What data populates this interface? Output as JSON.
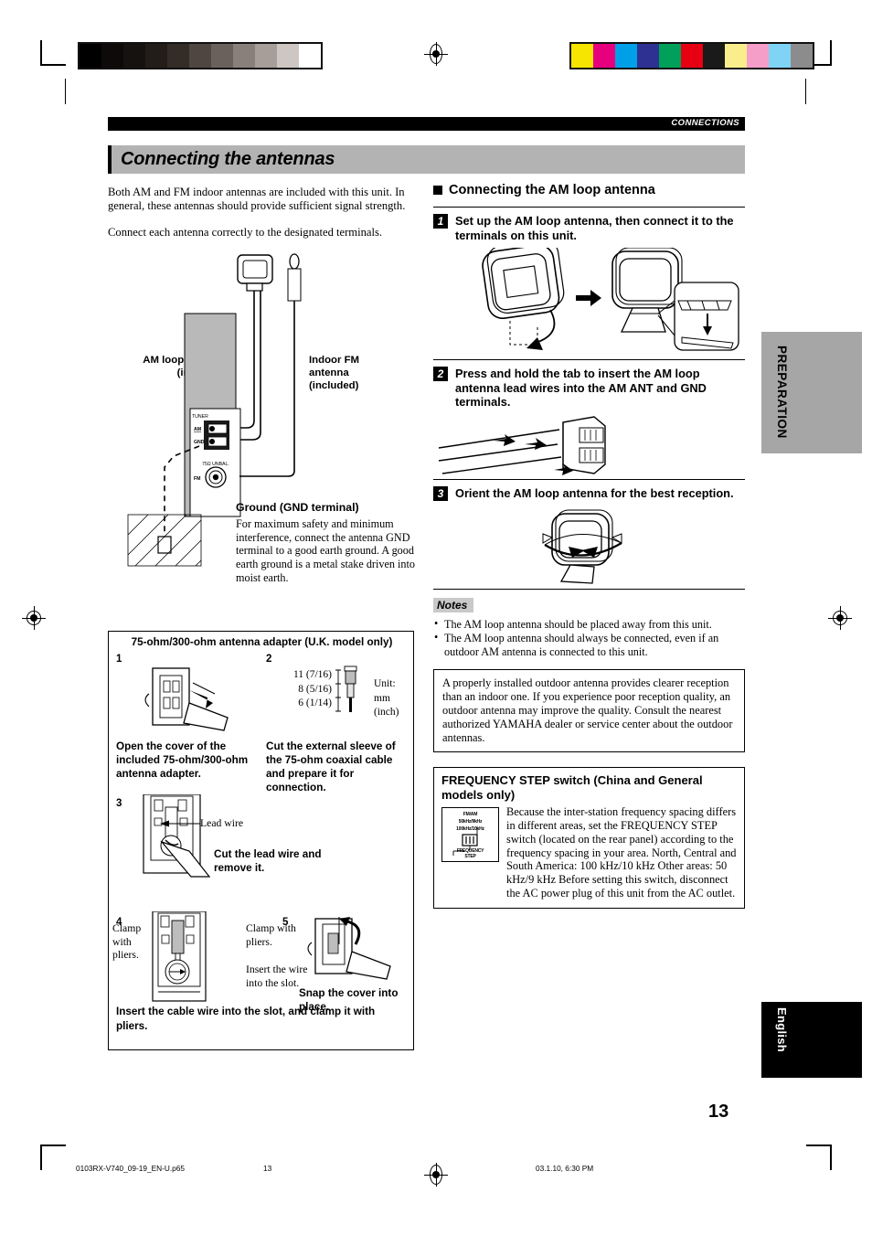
{
  "header": {
    "running_head": "CONNECTIONS"
  },
  "title": "Connecting the antennas",
  "intro": {
    "p1": "Both AM and FM indoor antennas are included with this unit. In general, these antennas should provide sufficient signal strength.",
    "p2": "Connect each antenna correctly to the designated terminals."
  },
  "diagram": {
    "am_label": "AM loop antenna",
    "am_label2": "(included)",
    "fm_label": "Indoor FM",
    "fm_label2": "antenna",
    "fm_label3": "(included)",
    "panel_tuner": "TUNER",
    "panel_am": "AM",
    "panel_gnd": "GND",
    "panel_unbal": "75Ω UNBAL.",
    "panel_fm": "FM",
    "gnd_heading": "Ground (GND terminal)",
    "gnd_text": "For maximum safety and minimum interference, connect the antenna GND terminal to a good earth ground. A good earth ground is a metal stake driven into moist earth."
  },
  "adapter": {
    "caption": "75-ohm/300-ohm antenna adapter (U.K. model only)",
    "steps": [
      {
        "num": "1",
        "text": "Open the cover of the included 75-ohm/300-ohm antenna adapter."
      },
      {
        "num": "2",
        "text": "Cut the external sleeve of the 75-ohm coaxial cable and prepare it for connection."
      },
      {
        "num": "3",
        "text": "Cut the lead wire and remove it."
      },
      {
        "num": "4",
        "text": "Insert the cable wire into the slot, and clamp it with pliers."
      },
      {
        "num": "5",
        "text": "Snap the cover into place."
      }
    ],
    "dims": [
      "11 (7/16)",
      "8 (5/16)",
      "6 (1/14)"
    ],
    "unit_l1": "Unit:",
    "unit_l2": "mm (inch)",
    "lead_wire_label": "Lead wire",
    "clamp_left": "Clamp with pliers.",
    "clamp_right": "Clamp with pliers.",
    "insert_slot": "Insert the wire into the slot."
  },
  "right": {
    "section_heading": "Connecting the AM loop antenna",
    "steps": [
      {
        "num": "1",
        "text": "Set up the AM loop antenna, then connect it to the terminals on this unit."
      },
      {
        "num": "2",
        "text": "Press and hold the tab to insert the AM loop antenna lead wires into the AM ANT and GND terminals."
      },
      {
        "num": "3",
        "text": "Orient the AM loop antenna for the best reception."
      }
    ],
    "notes_label": "Notes",
    "notes": [
      "The AM loop antenna should be placed away from this unit.",
      "The AM loop antenna should always be connected, even if an outdoor AM antenna is connected to this unit."
    ],
    "outdoor_box": "A properly installed outdoor antenna provides clearer reception than an indoor one. If you experience poor reception quality, an outdoor antenna may improve the quality. Consult the nearest authorized YAMAHA dealer or service center about the outdoor antennas.",
    "freq": {
      "heading": "FREQUENCY STEP switch (China and General models only)",
      "body": "Because the inter-station frequency spacing differs in different areas, set the FREQUENCY STEP switch (located on the rear panel) according to the frequency spacing in your area. North, Central and South America: 100 kHz/10 kHz Other areas: 50 kHz/9 kHz Before setting this switch, disconnect the AC power plug of this unit from the AC outlet.",
      "icon_l1": "FM/AM",
      "icon_l2": "50kHz/9kHz",
      "icon_l3": "100kHz/10kHz",
      "icon_l4": "FREQUENCY",
      "icon_l5": "STEP"
    }
  },
  "tabs": {
    "preparation": "PREPARATION",
    "english": "English"
  },
  "page_number": "13",
  "footer": {
    "filename": "0103RX-V740_09-19_EN-U.p65",
    "page": "13",
    "timestamp": "03.1.10, 6:30 PM"
  },
  "colors": {
    "title_bar": "#b3b3b3",
    "tab_gray": "#a6a6a6",
    "notes_tag": "#c9c9c9",
    "swatches_gray": [
      "#000000",
      "#0d0a09",
      "#161210",
      "#231d19",
      "#332c27",
      "#4f4641",
      "#6b615c",
      "#8a807b",
      "#a79e99",
      "#cdc6c2",
      "#ffffff"
    ],
    "swatches_color": [
      "#f5e500",
      "#e6007e",
      "#00a0e9",
      "#2e3192",
      "#00a05a",
      "#e60012",
      "#1a1a1a",
      "#faee8c",
      "#f59ec8",
      "#7fd4f5",
      "#8c8c8c"
    ]
  }
}
